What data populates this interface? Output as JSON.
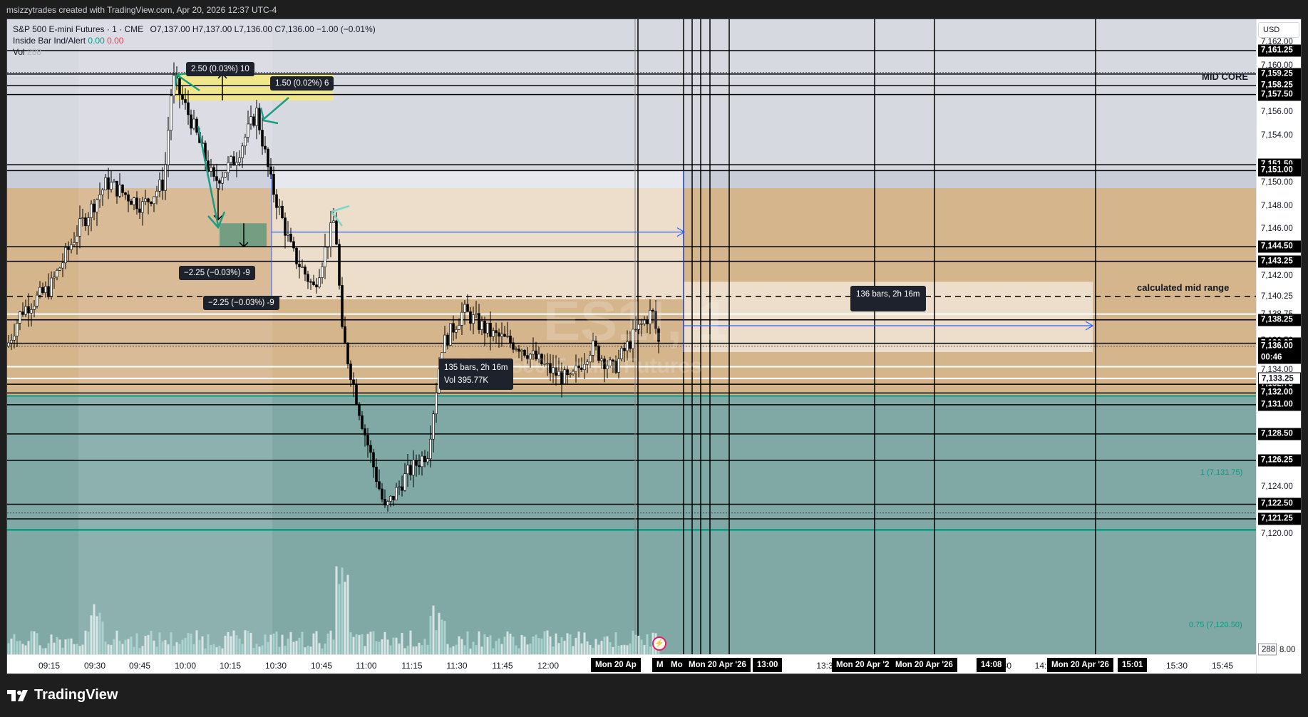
{
  "header": {
    "attribution": "msizzytrades created with TradingView.com, Apr 20, 2026 12:37 UTC-4"
  },
  "legend": {
    "symbol": "S&P 500 E-mini Futures · 1 · CME",
    "ohlc": "O7,137.00  H7,137.00  L7,136.00  C7,136.00  −1.00 (−0.01%)",
    "indicator_name": "Inside Bar Ind/Alert",
    "indicator_v1": "0.00",
    "indicator_v2": "0.00",
    "vol_label": "Vol",
    "vol_value": "288"
  },
  "currency": "USD",
  "price_axis": {
    "plain": [
      {
        "p": 7162.0,
        "t": "7,162.00"
      },
      {
        "p": 7160.0,
        "t": "7,160.00"
      },
      {
        "p": 7156.0,
        "t": "7,156.00"
      },
      {
        "p": 7154.0,
        "t": "7,154.00"
      },
      {
        "p": 7150.0,
        "t": "7,150.00"
      },
      {
        "p": 7148.0,
        "t": "7,148.00"
      },
      {
        "p": 7146.0,
        "t": "7,146.00"
      },
      {
        "p": 7142.0,
        "t": "7,142.00"
      },
      {
        "p": 7140.25,
        "t": "7,140.25"
      },
      {
        "p": 7138.75,
        "t": "7,138.75"
      },
      {
        "p": 7136.5,
        "t": "7,136.50"
      },
      {
        "p": 7134.0,
        "t": "7,134.00"
      },
      {
        "p": 7124.0,
        "t": "7,124.00"
      },
      {
        "p": 7120.0,
        "t": "7,120.00"
      }
    ],
    "tags": [
      {
        "p": 7161.25,
        "t": "7,161.25"
      },
      {
        "p": 7159.25,
        "t": "7,159.25"
      },
      {
        "p": 7158.25,
        "t": "7,158.25"
      },
      {
        "p": 7157.5,
        "t": "7,157.50"
      },
      {
        "p": 7151.5,
        "t": "7,151.50"
      },
      {
        "p": 7151.0,
        "t": "7,151.00"
      },
      {
        "p": 7144.5,
        "t": "7,144.50"
      },
      {
        "p": 7143.25,
        "t": "7,143.25"
      },
      {
        "p": 7138.25,
        "t": "7,138.25"
      },
      {
        "p": 7136.25,
        "t": "7,136.25"
      },
      {
        "p": 7136.0,
        "t": "7,136.00"
      },
      {
        "p": 7132.75,
        "t": "7,132.75"
      },
      {
        "p": 7132.0,
        "t": "7,132.00"
      },
      {
        "p": 7131.0,
        "t": "7,131.00"
      },
      {
        "p": 7128.5,
        "t": "7,128.50"
      },
      {
        "p": 7126.25,
        "t": "7,126.25"
      },
      {
        "p": 7122.5,
        "t": "7,122.50"
      },
      {
        "p": 7121.25,
        "t": "7,121.25"
      }
    ],
    "white_tags": [
      {
        "p": 7133.25,
        "t": "7,133.25"
      }
    ],
    "countdown": "00:46",
    "vol_tag": "288",
    "bottom_partial": "8.00"
  },
  "time_axis": {
    "labels": [
      "09:15",
      "09:30",
      "09:45",
      "10:00",
      "10:15",
      "10:30",
      "10:45",
      "11:00",
      "11:15",
      "11:30",
      "11:45",
      "12:00",
      "13:3",
      "14:30",
      "14:",
      "15:30",
      "15:45"
    ],
    "tags": [
      "Mon 20 Ap",
      "M",
      "Mo",
      "Mon 20 Apr '26",
      "13:00",
      "Mon 20 Apr '2",
      "Mon 20 Apr '26",
      "14:08",
      "Mon 20 Apr '26",
      "15:01"
    ]
  },
  "annotations": {
    "mid_core": "MID CORE",
    "calc_mid_range": "calculated mid range",
    "measure_1": "2.50 (0.03%) 10",
    "measure_2": "1.50 (0.02%) 6",
    "measure_3": "−2.25 (−0.03%) -9",
    "measure_4": "−2.25 (−0.03%) -9",
    "range_1_bars": "135 bars, 2h 16m",
    "range_1_vol": "Vol 395.77K",
    "range_2_bars": "136 bars, 2h 16m",
    "fib_1": "1 (7,131.75)",
    "fib_075": "0.75 (7,120.50)",
    "watermark_symbol": "ES1!, 1",
    "watermark_name": "S&P 500 E-mini Futures"
  },
  "footer": {
    "brand": "TradingView"
  },
  "colors": {
    "zone_tan": "#d5b58c",
    "zone_teal": "#80a9a6",
    "zone_grey": "#d7d9e1",
    "yellow_box": "#f4e77a",
    "blue_line": "#2962ff",
    "fib_teal": "#089981"
  }
}
